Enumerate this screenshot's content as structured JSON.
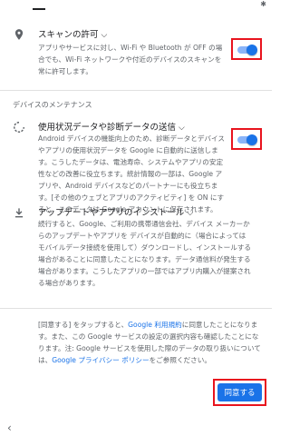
{
  "status_bar": {
    "bluetooth_icon": "bluetooth-icon"
  },
  "scan": {
    "icon": "location-pin-icon",
    "title": "スキャンの許可",
    "chevron": "chevron-down-icon",
    "description": "アプリやサービスに対し、Wi-Fi や Bluetooth が OFF の場合でも、Wi-Fi ネットワークや付近のデバイスのスキャンを常に許可します。",
    "enabled": true
  },
  "maintenance_header": "デバイスのメンテナンス",
  "usage": {
    "icon": "sync-icon",
    "title": "使用状況データや診断データの送信",
    "chevron": "chevron-down-icon",
    "description": "Android デバイスの機能向上のため、診断データとデバイスやアプリの使用状況データを Google に自動的に送信します。こうしたデータは、電池寿命、システムやアプリの安定性などの改善に役立ちます。統計情報の一部は、Google アプリや、Android デバイスなどのパートナーにも役立ちます。[その他のウェブとアプリのアクティビティ] を ON にすると、このデータは Google アカウントに保存されます。",
    "enabled": true
  },
  "updates": {
    "icon": "download-icon",
    "title": "アップデートやアプリのインストール",
    "chevron": "chevron-down-icon",
    "description": "続行すると、Google、ご利用の携帯通信会社、デバイス メーカーからのアップデートやアプリを デバイスが自動的に（場合によってはモバイルデータ接続を使用して）ダウンロードし、インストールする場合があることに同意したことになります。データ通信料が発生する場合があります。こうしたアプリの一部ではアプリ内購入が提案される場合があります。"
  },
  "consent": {
    "part1": "[同意する] をタップすると、",
    "link1": "Google 利用規約",
    "part2": "に同意したことになります。また、この Google サービスの設定の選択内容も確認したことになります。注: Google サービスを使用した際のデータの取り扱いについては、",
    "link2": "Google プライバシー ポリシー",
    "part3": "をご参照ください。"
  },
  "agree_button": "同意する",
  "nav": {
    "back_icon": "back-chevron-icon"
  },
  "colors": {
    "accent": "#1a73e8",
    "highlight": "#e8141e"
  }
}
